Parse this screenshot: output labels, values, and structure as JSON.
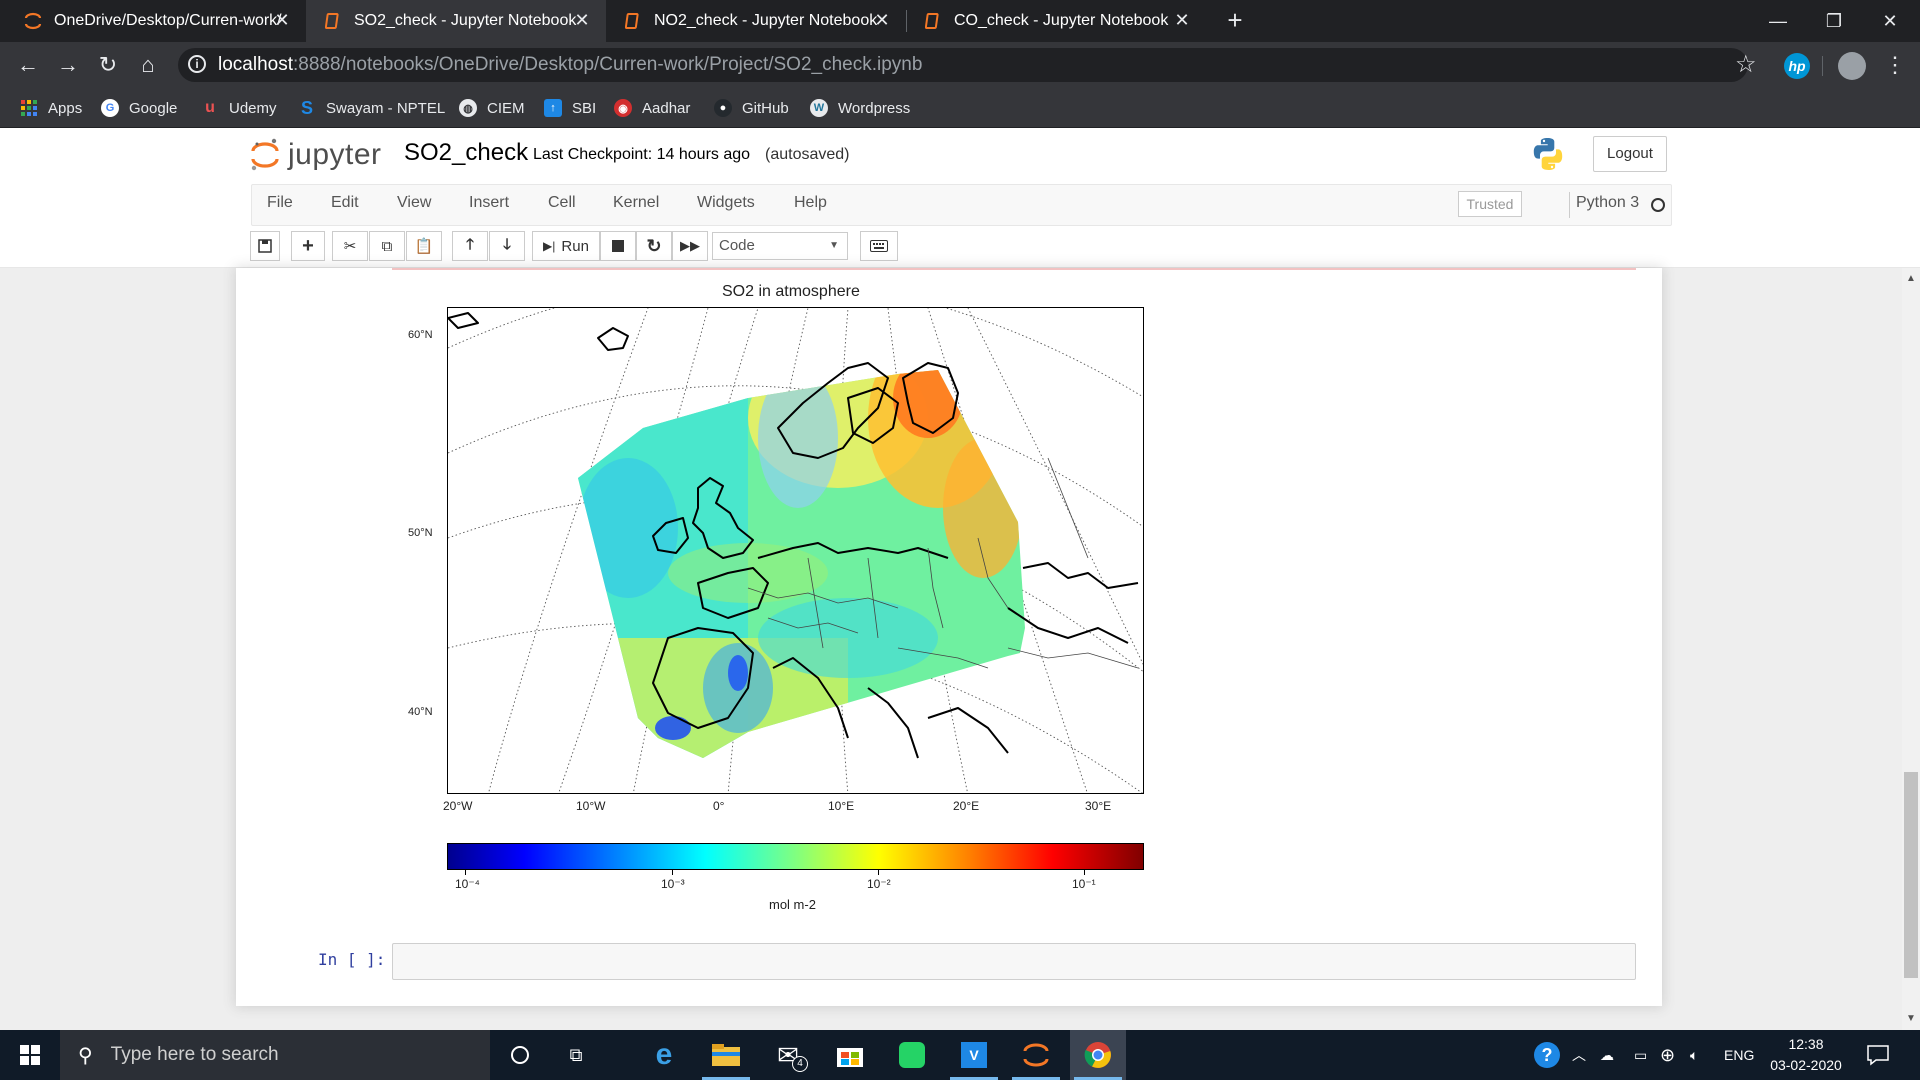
{
  "browser": {
    "tabs": [
      {
        "title": "OneDrive/Desktop/Curren-work/",
        "active": false
      },
      {
        "title": "SO2_check - Jupyter Notebook",
        "active": true
      },
      {
        "title": "NO2_check - Jupyter Notebook",
        "active": false
      },
      {
        "title": "CO_check - Jupyter Notebook",
        "active": false
      }
    ],
    "url_host": "localhost",
    "url_rest": ":8888/notebooks/OneDrive/Desktop/Curren-work/Project/SO2_check.ipynb",
    "bookmarks": [
      {
        "label": "Apps",
        "icon": "apps-grid-icon"
      },
      {
        "label": "Google",
        "icon": "google-icon"
      },
      {
        "label": "Udemy",
        "icon": "udemy-icon"
      },
      {
        "label": "Swayam - NPTEL",
        "icon": "swayam-icon"
      },
      {
        "label": "CIEM",
        "icon": "globe-icon"
      },
      {
        "label": "SBI",
        "icon": "sbi-icon"
      },
      {
        "label": "Aadhar",
        "icon": "aadhar-icon"
      },
      {
        "label": "GitHub",
        "icon": "github-icon"
      },
      {
        "label": "Wordpress",
        "icon": "wordpress-icon"
      }
    ]
  },
  "jupyter": {
    "logo_text": "jupyter",
    "notebook_name": "SO2_check",
    "checkpoint": "Last Checkpoint: 14 hours ago",
    "autosave": "(autosaved)",
    "logout": "Logout",
    "menu": [
      "File",
      "Edit",
      "View",
      "Insert",
      "Cell",
      "Kernel",
      "Widgets",
      "Help"
    ],
    "trusted": "Trusted",
    "kernel": "Python 3",
    "toolbar": {
      "run_label": "Run",
      "cell_type": "Code"
    },
    "prompt": "In [ ]:"
  },
  "chart_data": {
    "type": "heatmap",
    "title": "SO2 in atmosphere",
    "lat_labels": [
      "60°N",
      "50°N",
      "40°N"
    ],
    "lon_labels": [
      "20°W",
      "10°W",
      "0°",
      "10°E",
      "20°E",
      "30°E"
    ],
    "colorbar": {
      "scale": "log",
      "range": [
        0.0001,
        0.1
      ],
      "tick_labels": [
        "10⁻⁴",
        "10⁻³",
        "10⁻²",
        "10⁻¹"
      ],
      "label": "mol m-2",
      "colormap": "jet"
    }
  },
  "taskbar": {
    "search_placeholder": "Type here to search",
    "mail_badge": "4",
    "lang": "ENG",
    "time": "12:38",
    "date": "03-02-2020"
  },
  "colors": {
    "jupyter_orange": "#f37726",
    "prompt_blue": "#303f9f",
    "chrome_dark": "#202124"
  }
}
